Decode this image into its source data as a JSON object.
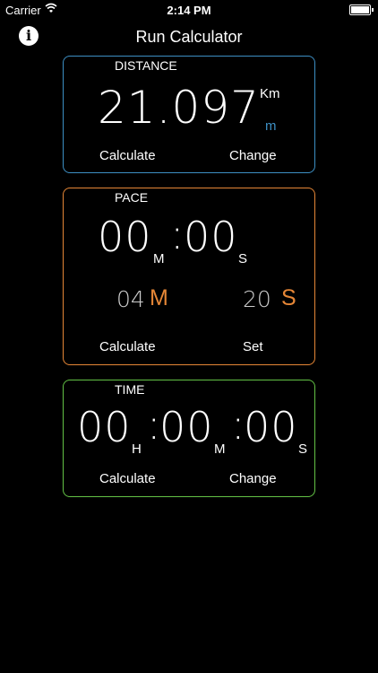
{
  "status_bar": {
    "carrier": "Carrier",
    "time": "2:14 PM"
  },
  "nav": {
    "title": "Run Calculator"
  },
  "distance": {
    "label": "DISTANCE",
    "value": "21.097",
    "unit_km": "Km",
    "unit_m": "m",
    "calculate": "Calculate",
    "change": "Change",
    "color": "#3d8fc4"
  },
  "pace": {
    "label": "PACE",
    "minutes": "00",
    "min_unit": "M",
    "seconds": "00",
    "sec_unit": "S",
    "set_minutes": "04",
    "set_min_unit": "M",
    "set_seconds": "20",
    "set_sec_unit": "S",
    "calculate": "Calculate",
    "set": "Set",
    "color": "#e58636"
  },
  "time": {
    "label": "TIME",
    "hours": "00",
    "hour_unit": "H",
    "minutes": "00",
    "min_unit": "M",
    "seconds": "00",
    "sec_unit": "S",
    "calculate": "Calculate",
    "change": "Change",
    "color": "#63c245"
  }
}
